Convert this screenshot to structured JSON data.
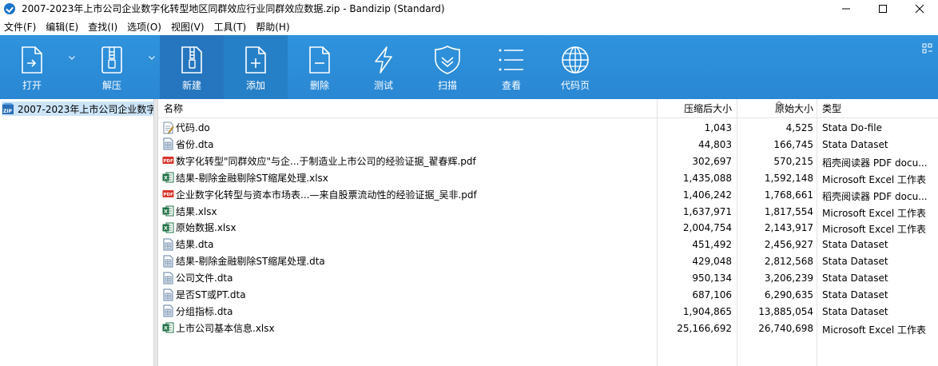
{
  "window": {
    "title": "2007-2023年上市公司企业数字化转型地区同群效应行业同群效应数据.zip - Bandizip (Standard)"
  },
  "menu": [
    "文件(F)",
    "编辑(E)",
    "查找(I)",
    "选项(O)",
    "视图(V)",
    "工具(T)",
    "帮助(H)"
  ],
  "toolbar": {
    "open": "打开",
    "extract": "解压",
    "new": "新建",
    "add": "添加",
    "delete": "删除",
    "test": "测试",
    "scan": "扫描",
    "view": "查看",
    "codepage": "代码页"
  },
  "tree": {
    "root": "2007-2023年上市公司企业数字"
  },
  "columns": {
    "name": "名称",
    "packed": "压缩后大小",
    "original": "原始大小",
    "type": "类型"
  },
  "files": [
    {
      "name": "代码.do",
      "packed": "1,043",
      "original": "4,525",
      "type": "Stata Do-file",
      "icon": "do"
    },
    {
      "name": "省份.dta",
      "packed": "44,803",
      "original": "166,745",
      "type": "Stata Dataset",
      "icon": "dta"
    },
    {
      "name": "数字化转型\"同群效应\"与企...于制造业上市公司的经验证据_翟春辉.pdf",
      "packed": "302,697",
      "original": "570,215",
      "type": "稻壳阅读器 PDF docu...",
      "icon": "pdf"
    },
    {
      "name": "结果-剔除金融剔除ST缩尾处理.xlsx",
      "packed": "1,435,088",
      "original": "1,592,148",
      "type": "Microsoft Excel 工作表",
      "icon": "xlsx"
    },
    {
      "name": "企业数字化转型与资本市场表...—来自股票流动性的经验证据_吴非.pdf",
      "packed": "1,406,242",
      "original": "1,768,661",
      "type": "稻壳阅读器 PDF docu...",
      "icon": "pdf"
    },
    {
      "name": "结果.xlsx",
      "packed": "1,637,971",
      "original": "1,817,554",
      "type": "Microsoft Excel 工作表",
      "icon": "xlsx"
    },
    {
      "name": "原始数据.xlsx",
      "packed": "2,004,754",
      "original": "2,143,917",
      "type": "Microsoft Excel 工作表",
      "icon": "xlsx"
    },
    {
      "name": "结果.dta",
      "packed": "451,492",
      "original": "2,456,927",
      "type": "Stata Dataset",
      "icon": "dta"
    },
    {
      "name": "结果-剔除金融剔除ST缩尾处理.dta",
      "packed": "429,048",
      "original": "2,812,568",
      "type": "Stata Dataset",
      "icon": "dta"
    },
    {
      "name": "公司文件.dta",
      "packed": "950,134",
      "original": "3,206,239",
      "type": "Stata Dataset",
      "icon": "dta"
    },
    {
      "name": "是否ST或PT.dta",
      "packed": "687,106",
      "original": "6,290,635",
      "type": "Stata Dataset",
      "icon": "dta"
    },
    {
      "name": "分组指标.dta",
      "packed": "1,904,865",
      "original": "13,885,054",
      "type": "Stata Dataset",
      "icon": "dta"
    },
    {
      "name": "上市公司基本信息.xlsx",
      "packed": "25,166,692",
      "original": "26,740,698",
      "type": "Microsoft Excel 工作表",
      "icon": "xlsx"
    }
  ],
  "colors": {
    "toolbar": "#2a87d3",
    "selection": "#cce4f7",
    "excel": "#1e7145",
    "pdf": "#d9342b"
  }
}
